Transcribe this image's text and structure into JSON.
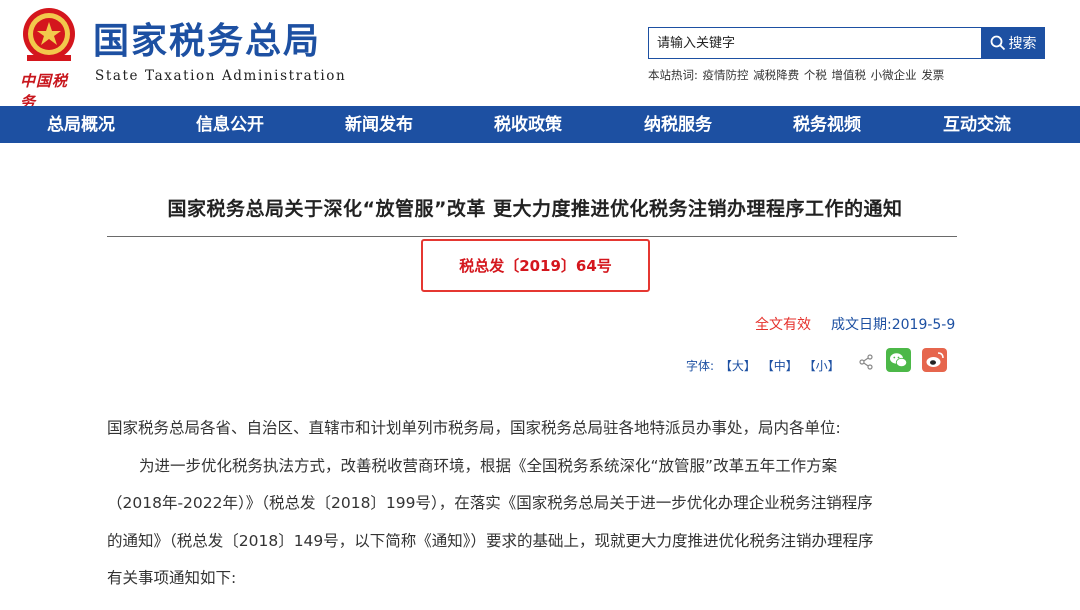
{
  "header": {
    "brand_cn": "国家税务总局",
    "brand_en": "State Taxation Administration",
    "emblem_caption": "中国税务"
  },
  "search": {
    "placeholder": "请输入关键字",
    "button_label": "搜索",
    "hot_label": "本站热词:",
    "hot_words": [
      "疫情防控",
      "减税降费",
      "个税",
      "增值税",
      "小微企业",
      "发票"
    ]
  },
  "nav": {
    "items": [
      "总局概况",
      "信息公开",
      "新闻发布",
      "税收政策",
      "纳税服务",
      "税务视频",
      "互动交流"
    ]
  },
  "article": {
    "title": "国家税务总局关于深化“放管服”改革 更大力度推进优化税务注销办理程序工作的通知",
    "doc_number": "税总发〔2019〕64号",
    "validity": "全文有效",
    "date": "成文日期:2019-5-9",
    "font_label": "字体:",
    "font_sizes": [
      "【大】",
      "【中】",
      "【小】"
    ],
    "paragraphs": [
      "国家税务总局各省、自治区、直辖市和计划单列市税务局，国家税务总局驻各地特派员办事处，局内各单位:",
      "为进一步优化税务执法方式，改善税收营商环境，根据《全国税务系统深化“放管服”改革五年工作方案",
      "（2018年-2022年）》（税总发〔2018〕199号），在落实《国家税务总局关于进一步优化办理企业税务注销程序",
      "的通知》（税总发〔2018〕149号，以下简称《通知》）要求的基础上，现就更大力度推进优化税务注销办理程序",
      "有关事项通知如下:"
    ]
  },
  "colors": {
    "brand_blue": "#1d50a2",
    "alert_red": "#e5322d",
    "wechat_green": "#4cb848",
    "weibo_orange": "#e6664d"
  },
  "icons": [
    "search-icon",
    "share-icon",
    "wechat-icon",
    "weibo-icon",
    "emblem-icon"
  ]
}
